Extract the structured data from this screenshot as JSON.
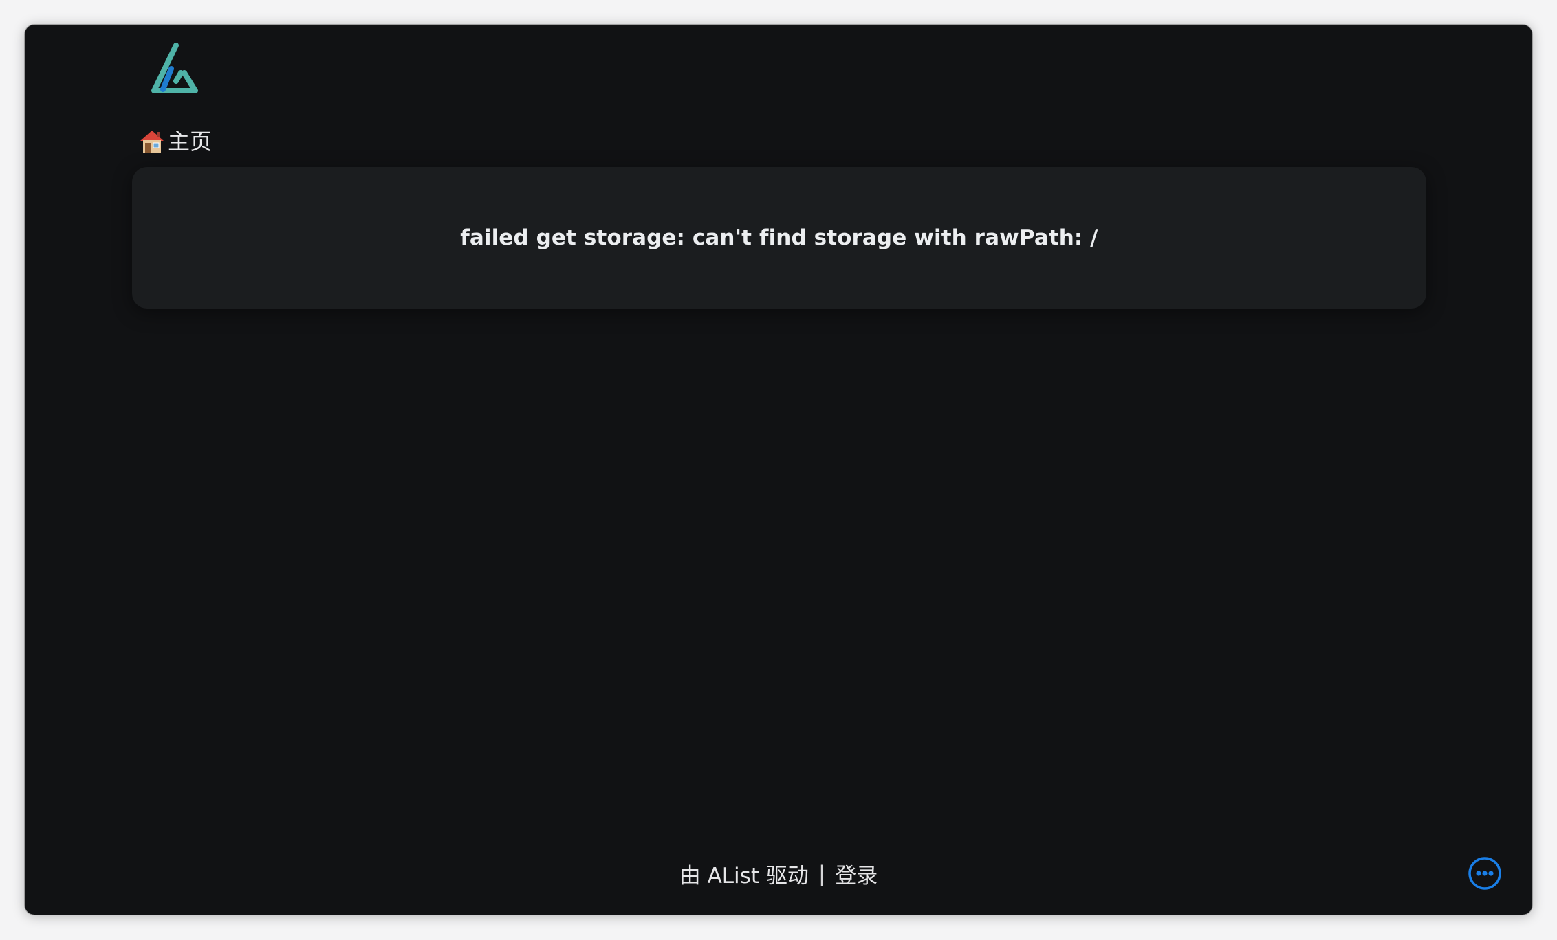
{
  "header": {
    "logo_icon": "alist-logo-icon",
    "logo_colors": {
      "outline": "#4fb3a8",
      "stripe": "#1f7ccf"
    }
  },
  "breadcrumb": {
    "icon": "house-icon",
    "label": "主页"
  },
  "error": {
    "message": "failed get storage: can't find storage with rawPath: /"
  },
  "footer": {
    "powered_by": "由 AList 驱动",
    "separator": "|",
    "login_label": "登录"
  },
  "floating_menu": {
    "icon": "more-horizontal-icon",
    "color": "#1a7fe8"
  },
  "theme": {
    "background": "#111214",
    "card_background": "#1b1d1f",
    "text": "#e8e8ea"
  }
}
